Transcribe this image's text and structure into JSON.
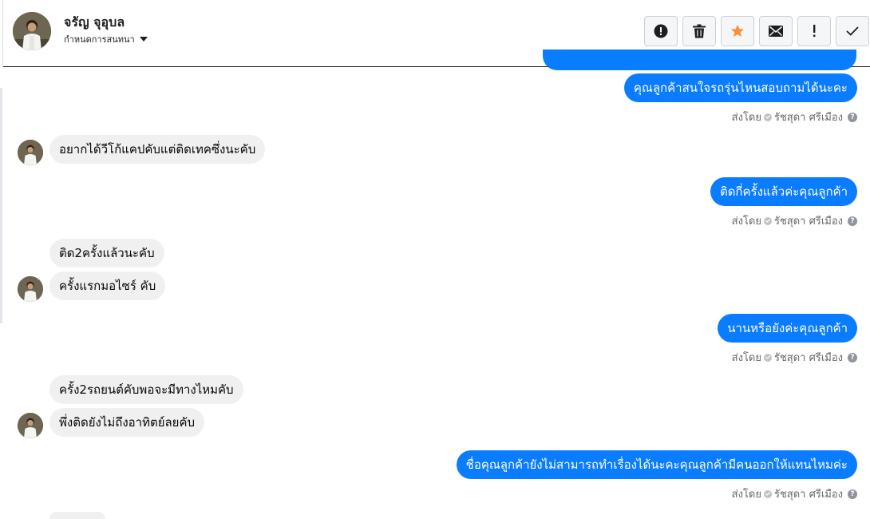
{
  "header": {
    "contact_name": "จรัญ จุอุบล",
    "subtitle": "กำหนดการสนทนา",
    "actions": [
      {
        "name": "report-icon",
        "label": "report"
      },
      {
        "name": "trash-icon",
        "label": "delete"
      },
      {
        "name": "star-icon",
        "label": "star"
      },
      {
        "name": "mail-icon",
        "label": "mark unread"
      },
      {
        "name": "exclamation-icon",
        "label": "spam"
      },
      {
        "name": "check-icon",
        "label": "done"
      }
    ],
    "star_color": "#f7923a"
  },
  "messages": [
    {
      "dir": "out",
      "text": "คุณลูกค้าสนใจรถรุ่นไหนสอบถามได้นะคะ",
      "sent_by_prefix": "ส่งโดย",
      "sent_by": "รัชสุดา ศรีเมือง"
    },
    {
      "dir": "in",
      "text": "อยากได้วีโก้แคปคับแต่ติดเทคซึ่งนะคับ"
    },
    {
      "dir": "out",
      "text": "ติดกี่ครั้งแล้วค่ะคุณลูกค้า",
      "sent_by_prefix": "ส่งโดย",
      "sent_by": "รัชสุดา ศรีเมือง"
    },
    {
      "dir": "in",
      "text": "ติด2ครั้งแล้วนะคับ"
    },
    {
      "dir": "in",
      "text": "ครั้งแรกมอไซร์  คับ"
    },
    {
      "dir": "out",
      "text": "นานหรือยังค่ะคุณลูกค้า",
      "sent_by_prefix": "ส่งโดย",
      "sent_by": "รัชสุดา ศรีเมือง"
    },
    {
      "dir": "in",
      "text": "ครั้ง2รถยนต์คับพอจะมีทางไหมคับ"
    },
    {
      "dir": "in",
      "text": "พึ่งติดยังไม่ถึงอาทิตย์ลยคับ"
    },
    {
      "dir": "out",
      "text": "ชื่อคุณลูกค้ายังไม่สามารถทำเรื่องได้นะคะคุณลูกค้ามีคนออกให้แทนไหมค่ะ",
      "sent_by_prefix": "ส่งโดย",
      "sent_by": "รัชสุดา ศรีเมือง"
    }
  ],
  "colors": {
    "outgoing": "#0a7cff",
    "incoming": "#f0f0f0"
  }
}
